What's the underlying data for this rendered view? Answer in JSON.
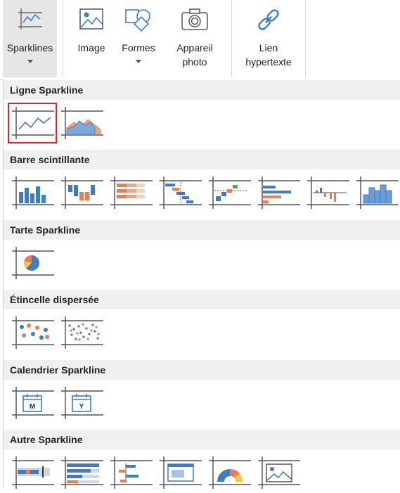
{
  "ribbon": {
    "sparklines_label": "Sparklines",
    "image_label": "Image",
    "shapes_label": "Formes",
    "camera_label_line1": "Appareil",
    "camera_label_line2": "photo",
    "link_label_line1": "Lien",
    "link_label_line2": "hypertexte"
  },
  "sections": {
    "line": "Ligne Sparkline",
    "bar": "Barre scintillante",
    "pie": "Tarte Sparkline",
    "scatter": "Étincelle dispersée",
    "calendar": "Calendrier Sparkline",
    "other": "Autre Sparkline"
  },
  "calendar_letters": {
    "month": "M",
    "year": "Y"
  },
  "colors": {
    "blue": "#3d7cc9",
    "orange": "#f07b52",
    "frame": "#555555",
    "selected_border": "#d9262b",
    "header_bg": "#f0f0f0"
  }
}
